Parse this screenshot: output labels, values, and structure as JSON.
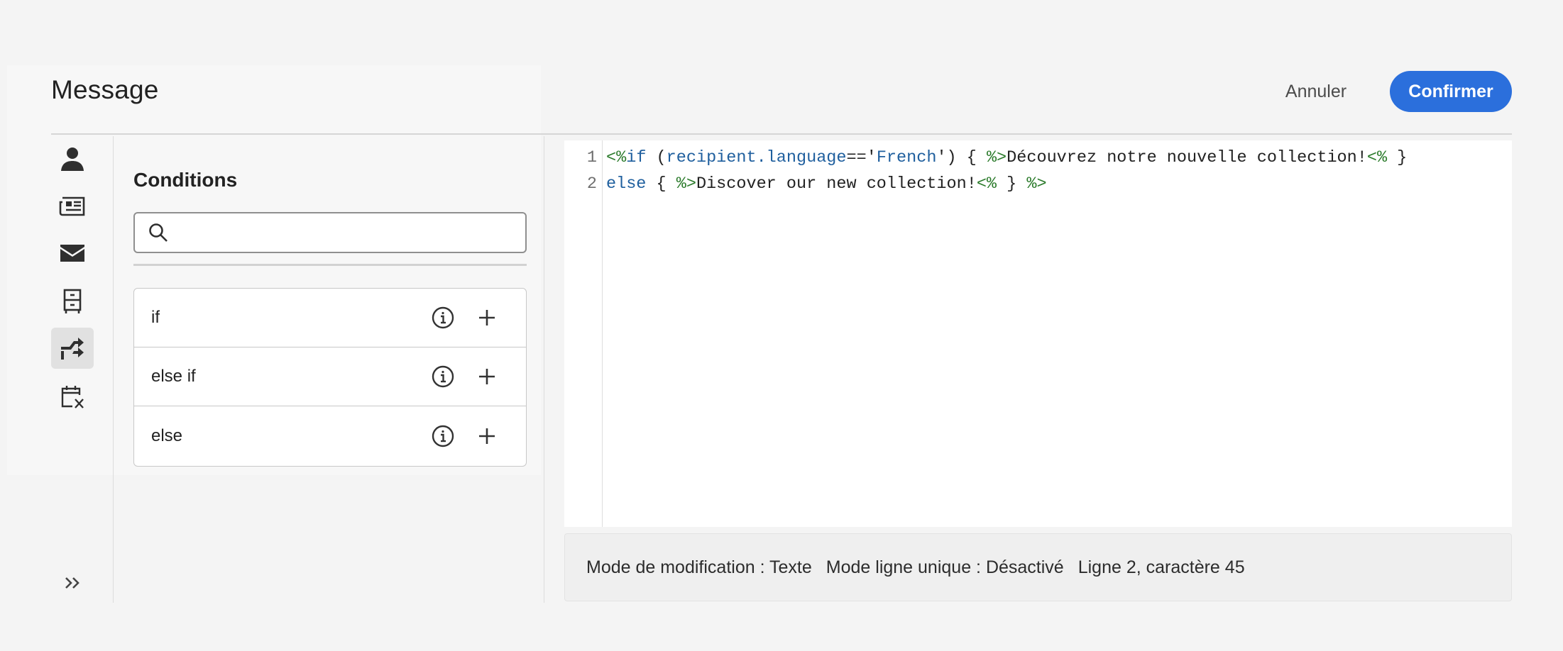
{
  "header": {
    "title": "Message",
    "cancel_label": "Annuler",
    "confirm_label": "Confirmer",
    "accent_color": "#2b6fdc"
  },
  "rail": {
    "items": [
      {
        "icon": "user-icon",
        "active": false
      },
      {
        "icon": "newspaper-icon",
        "active": false
      },
      {
        "icon": "envelope-icon",
        "active": false
      },
      {
        "icon": "cabinet-icon",
        "active": false
      },
      {
        "icon": "conditions-icon",
        "active": true
      },
      {
        "icon": "calendar-function-icon",
        "active": false
      }
    ],
    "expand_icon": "double-chevron-right-icon"
  },
  "conditions": {
    "heading": "Conditions",
    "search": {
      "placeholder": "",
      "value": "",
      "icon": "search-icon"
    },
    "items": [
      {
        "label": "if"
      },
      {
        "label": "else if"
      },
      {
        "label": "else"
      }
    ]
  },
  "editor": {
    "lines": [
      {
        "number": "1",
        "text": "<%if (recipient.language=='French') { %>Découvrez notre nouvelle collection!<% }"
      },
      {
        "number": "2",
        "text": "else { %>Discover our new collection!<% } %>"
      }
    ]
  },
  "status": {
    "edit_mode": "Mode de modification : Texte",
    "single_line": "Mode ligne unique : Désactivé",
    "position": "Ligne 2, caractère 45"
  }
}
